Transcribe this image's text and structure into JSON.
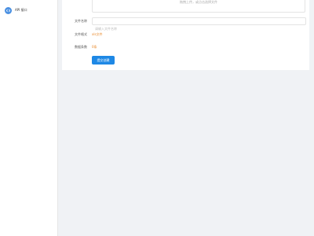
{
  "sidebar": {
    "items": [
      {
        "label": "API 接口",
        "icon": "api-icon"
      }
    ]
  },
  "form": {
    "upload_hint": "拖拽上传，或点击选择文件",
    "file_name": {
      "label": "文件名称",
      "placeholder": "请输入文件名称",
      "value": ""
    },
    "file_format": {
      "label": "文件格式",
      "value": "xls文件"
    },
    "record_count": {
      "label": "数据条数",
      "value": "0条"
    },
    "submit_label": "提交创建"
  },
  "colors": {
    "accent": "#1e88e5",
    "highlight": "#e8892b",
    "background": "#f0f2f5"
  }
}
